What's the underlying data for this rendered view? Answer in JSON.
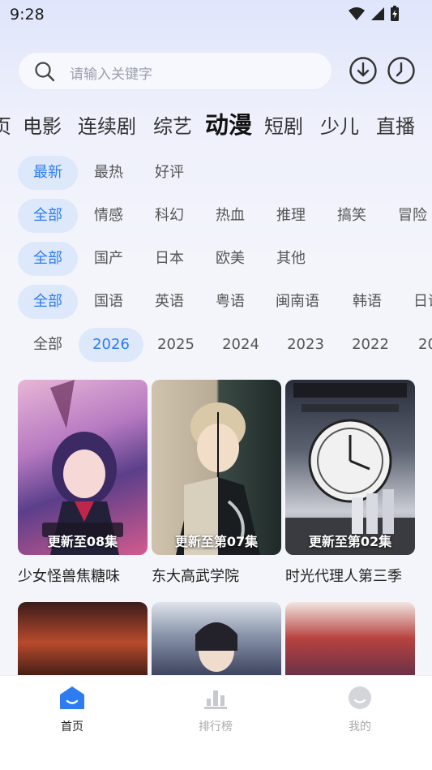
{
  "status_bar": {
    "time": "9:28"
  },
  "search": {
    "placeholder": "请输入关键字"
  },
  "channels": [
    "页",
    "电影",
    "连续剧",
    "综艺",
    "动漫",
    "短剧",
    "少儿",
    "直播"
  ],
  "active_channel": "动漫",
  "filters": {
    "sort": [
      "最新",
      "最热",
      "好评"
    ],
    "genre": [
      "全部",
      "情感",
      "科幻",
      "热血",
      "推理",
      "搞笑",
      "冒险"
    ],
    "region": [
      "全部",
      "国产",
      "日本",
      "欧美",
      "其他"
    ],
    "language": [
      "全部",
      "国语",
      "英语",
      "粤语",
      "闽南语",
      "韩语",
      "日语"
    ],
    "year": [
      "全部",
      "2026",
      "2025",
      "2024",
      "2023",
      "2022",
      "20"
    ]
  },
  "cards": [
    {
      "title": "少女怪兽焦糖味",
      "badge": "更新至08集"
    },
    {
      "title": "东大高武学院",
      "badge": "更新至第07集"
    },
    {
      "title": "时光代理人第三季",
      "badge": "更新至第02集"
    }
  ],
  "bottom_nav": [
    {
      "label": "首页",
      "active": true
    },
    {
      "label": "排行榜",
      "active": false
    },
    {
      "label": "我的",
      "active": false
    }
  ],
  "colors": {
    "accent": "#2d7cf0",
    "chip_bg": "#dde8fb"
  }
}
